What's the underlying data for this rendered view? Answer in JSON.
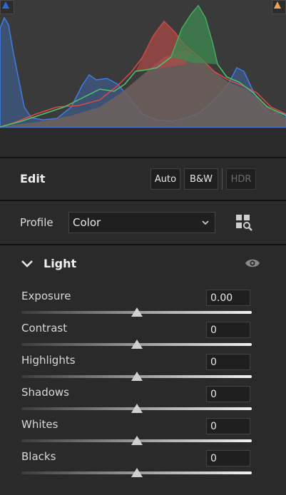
{
  "histogram": {
    "left_clip_color": "#2a6ad8",
    "right_clip_color": "#f2a255"
  },
  "edit": {
    "title": "Edit",
    "auto_label": "Auto",
    "bw_label": "B&W",
    "hdr_label": "HDR"
  },
  "profile": {
    "label": "Profile",
    "value": "Color"
  },
  "light": {
    "title": "Light",
    "sliders": [
      {
        "label": "Exposure",
        "value": "0.00",
        "level": 0.5
      },
      {
        "label": "Contrast",
        "value": "0",
        "level": 0.5
      },
      {
        "label": "Highlights",
        "value": "0",
        "level": 0.5
      },
      {
        "label": "Shadows",
        "value": "0",
        "level": 0.5
      },
      {
        "label": "Whites",
        "value": "0",
        "level": 0.5
      },
      {
        "label": "Blacks",
        "value": "0",
        "level": 0.5
      }
    ]
  },
  "icons": {
    "clip_left": "shadow-clipping-icon",
    "clip_right": "highlight-clipping-icon",
    "dropdown": "chevron-down-icon",
    "browse": "profile-browser-icon",
    "collapse": "chevron-down-icon",
    "visibility": "eye-icon"
  }
}
